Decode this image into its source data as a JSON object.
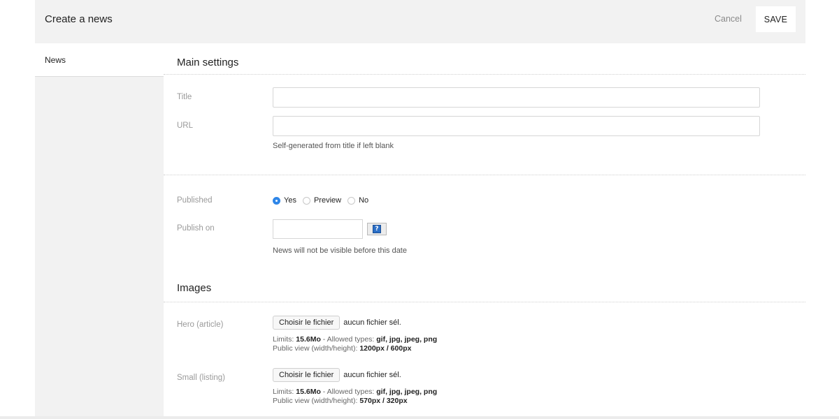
{
  "header": {
    "title": "Create a news",
    "cancel_label": "Cancel",
    "save_label": "SAVE"
  },
  "sidebar": {
    "items": [
      {
        "label": "News"
      }
    ]
  },
  "main_settings": {
    "section_title": "Main settings",
    "title_label": "Title",
    "title_value": "",
    "url_label": "URL",
    "url_value": "",
    "url_hint": "Self-generated from title if left blank",
    "published_label": "Published",
    "published_options": [
      {
        "label": "Yes",
        "checked": true
      },
      {
        "label": "Preview",
        "checked": false
      },
      {
        "label": "No",
        "checked": false
      }
    ],
    "publish_on_label": "Publish on",
    "publish_on_value": "",
    "publish_on_hint": "News will not be visible before this date",
    "calendar_button_glyph": "?"
  },
  "images": {
    "section_title": "Images",
    "fields": [
      {
        "label": "Hero (article)",
        "button_label": "Choisir le fichier",
        "status": "aucun fichier sél.",
        "limits_prefix": "Limits: ",
        "limits_size": "15.6Mo",
        "types_prefix": " - Allowed types: ",
        "types": "gif, jpg, jpeg, png",
        "view_prefix": "Public view (width/height): ",
        "view": "1200px / 600px"
      },
      {
        "label": "Small (listing)",
        "button_label": "Choisir le fichier",
        "status": "aucun fichier sél.",
        "limits_prefix": "Limits: ",
        "limits_size": "15.6Mo",
        "types_prefix": " - Allowed types: ",
        "types": "gif, jpg, jpeg, png",
        "view_prefix": "Public view (width/height): ",
        "view": "570px / 320px"
      }
    ]
  },
  "colors": {
    "accent": "#2f86e8",
    "panel": "#f2f2f2",
    "label": "#9a9a9a"
  },
  "icons": {
    "calendar": "calendar-icon"
  }
}
